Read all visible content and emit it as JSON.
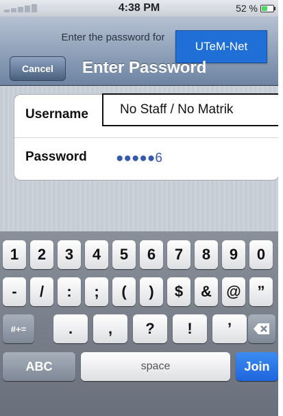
{
  "status_bar": {
    "time": "4:38 PM",
    "battery_percent": "52 %",
    "battery_level": 0.52
  },
  "header": {
    "prompt": "Enter the password for",
    "network_name": "UTeM-Net",
    "cancel_label": "Cancel",
    "title": "Enter Password"
  },
  "form": {
    "username_label": "Username",
    "username_placeholder": "No Staff / No Matrik",
    "password_label": "Password",
    "password_value": "●●●●●6"
  },
  "keyboard": {
    "row1": [
      "1",
      "2",
      "3",
      "4",
      "5",
      "6",
      "7",
      "8",
      "9",
      "0"
    ],
    "row2": [
      "-",
      "/",
      ":",
      ";",
      "(",
      ")",
      "$",
      "&",
      "@",
      "”"
    ],
    "row3_left": "#+=",
    "row3": [
      ".",
      ",",
      "?",
      "!",
      "’"
    ],
    "mode_label": "ABC",
    "space_label": "space",
    "join_label": "Join"
  },
  "colors": {
    "accent": "#1f6fd6",
    "join": "#2a74e6",
    "password_text": "#375aa8"
  }
}
